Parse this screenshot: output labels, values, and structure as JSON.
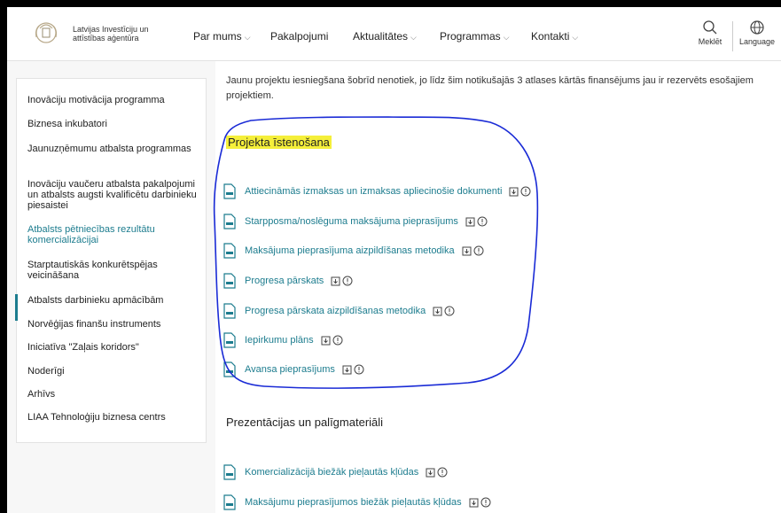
{
  "header": {
    "org_name": "Latvijas Investīciju un attīstības aģentūra",
    "nav": [
      {
        "label": "Par mums",
        "dropdown": true
      },
      {
        "label": "Pakalpojumi",
        "dropdown": false
      },
      {
        "label": "Aktualitātes",
        "dropdown": true
      },
      {
        "label": "Programmas",
        "dropdown": true
      },
      {
        "label": "Kontakti",
        "dropdown": true
      }
    ],
    "search_label": "Meklēt",
    "language_label": "Language"
  },
  "sidebar": {
    "items": [
      {
        "label": "Inovāciju motivācija programma"
      },
      {
        "label": "Biznesa inkubatori"
      },
      {
        "label": "Jaunuzņēmumu atbalsta programmas"
      },
      {
        "label": "Inovāciju vaučeru atbalsta pakalpojumi un atbalsts augsti kvalificētu darbinieku piesaistei"
      },
      {
        "label": "Atbalsts pētniecības rezultātu komercializācijai",
        "active": true
      },
      {
        "label": "Starptautiskās konkurētspējas veicināšana"
      },
      {
        "label": "Atbalsts darbinieku apmācībām"
      },
      {
        "label": "Norvēģijas finanšu instruments"
      },
      {
        "label": "Iniciatīva \"Zaļais koridors\""
      },
      {
        "label": "Noderīgi"
      },
      {
        "label": "Arhīvs"
      },
      {
        "label": "LIAA Tehnoloģiju biznesa centrs"
      }
    ]
  },
  "main": {
    "intro": "Jaunu projektu iesniegšana šobrīd nenotiek, jo līdz šim notikušajās 3 atlases kārtās finansējums jau ir rezervēts esošajiem projektiem.",
    "section_implementation": {
      "title": "Projekta īstenošana",
      "documents": [
        {
          "label": "Attiecināmās izmaksas un izmaksas apliecinošie dokumenti"
        },
        {
          "label": "Starpposma/noslēguma maksājuma pieprasījums"
        },
        {
          "label": "Maksājuma pieprasījuma aizpildīšanas metodika"
        },
        {
          "label": "Progresa pārskats"
        },
        {
          "label": "Progresa pārskata aizpildīšanas metodika"
        },
        {
          "label": "Iepirkumu plāns"
        },
        {
          "label": "Avansa pieprasījums"
        }
      ]
    },
    "section_presentations": {
      "title": "Prezentācijas un palīgmateriāli",
      "documents": [
        {
          "label": "Komercializācijā biežāk pieļautās kļūdas"
        },
        {
          "label": "Maksājumu pieprasījumos biežāk pieļautās kļūdas"
        }
      ]
    }
  },
  "colors": {
    "link": "#1c7c8e",
    "highlight": "#f5ef3a",
    "annotation": "#1a2bd6"
  }
}
